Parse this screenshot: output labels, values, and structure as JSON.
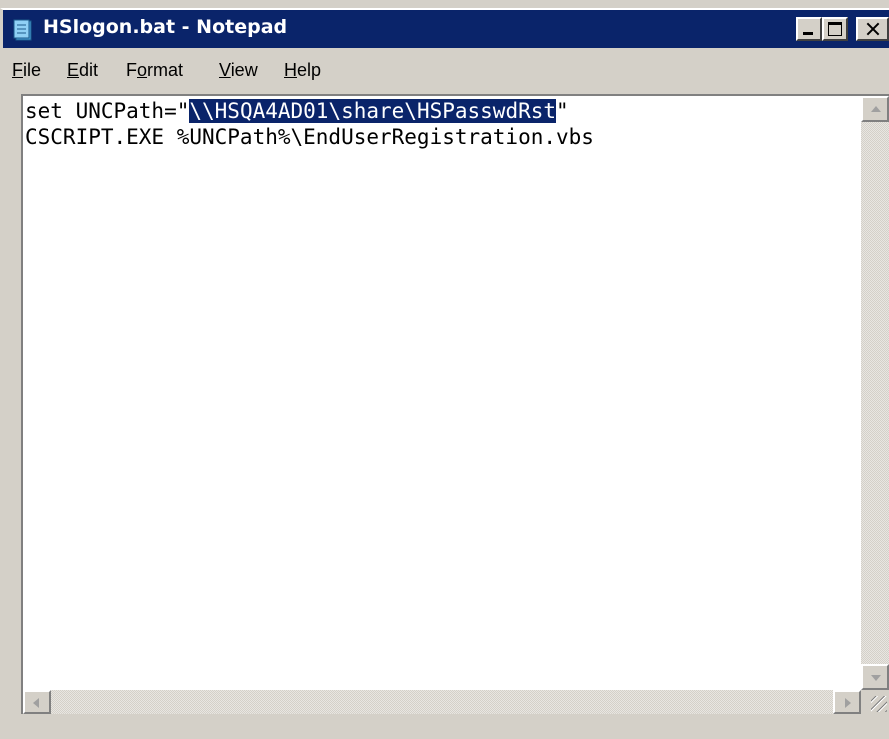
{
  "window": {
    "title": "HSlogon.bat - Notepad",
    "app_icon": "notepad-icon"
  },
  "caption_buttons": {
    "minimize": "minimize-icon",
    "maximize": "maximize-icon",
    "close": "close-icon"
  },
  "menu": {
    "file": {
      "accel": "F",
      "rest": "ile"
    },
    "edit": {
      "accel": "E",
      "rest": "dit"
    },
    "format": {
      "pre": "F",
      "accel": "o",
      "rest": "rmat"
    },
    "view": {
      "accel": "V",
      "rest": "iew"
    },
    "help": {
      "accel": "H",
      "rest": "elp"
    }
  },
  "document": {
    "line1_before": "set UNCPath=\"",
    "line1_selected": "\\\\HSQA4AD01\\share\\HSPasswdRst",
    "line1_after": "\"",
    "line2": "CSCRIPT.EXE %UNCPath%\\EndUserRegistration.vbs"
  },
  "colors": {
    "title_bar": "#0a246a",
    "selection_bg": "#0a246a",
    "selection_fg": "#ffffff",
    "chrome": "#d4d0c8"
  }
}
